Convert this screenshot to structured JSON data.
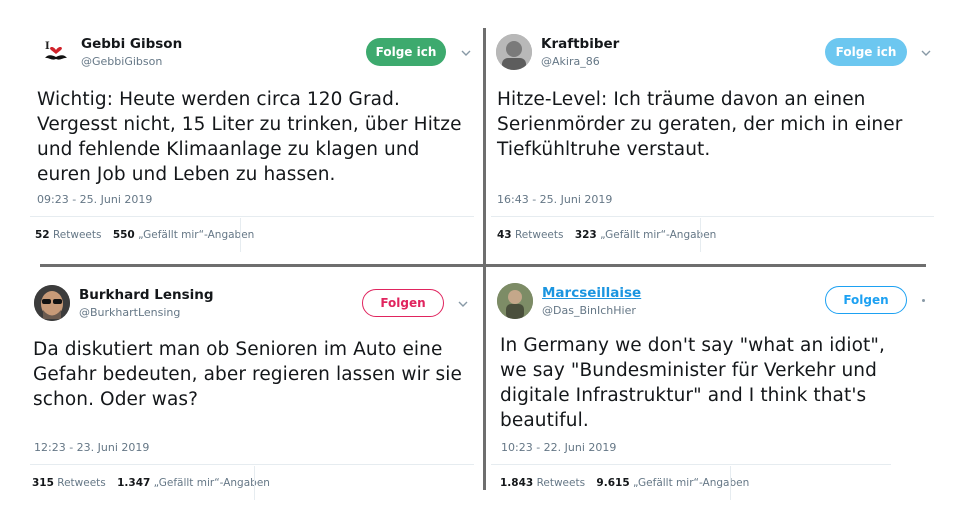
{
  "tweets": [
    {
      "name": "Gebbi Gibson",
      "handle": "@GebbiGibson",
      "follow_label": "Folge ich",
      "lines": [
        "Wichtig: Heute werden circa 120 Grad.",
        "Vergesst nicht, 15 Liter zu trinken, über Hitze",
        "und fehlende Klimaanlage zu klagen und",
        "euren Job und Leben zu hassen."
      ],
      "timestamp": "09:23 - 25. Juni 2019",
      "retweets": "52",
      "retweets_label": "Retweets",
      "likes": "550",
      "likes_label": "„Gefällt mir“-Angaben"
    },
    {
      "name": "Kraftbiber",
      "handle": "@Akira_86",
      "follow_label": "Folge ich",
      "lines": [
        "Hitze-Level: Ich träume davon an einen",
        "Serienmörder zu geraten, der mich in einer",
        "Tiefkühltruhe verstaut."
      ],
      "timestamp": "16:43 - 25. Juni 2019",
      "retweets": "43",
      "retweets_label": "Retweets",
      "likes": "323",
      "likes_label": "„Gefällt mir“-Angaben"
    },
    {
      "name": "Burkhard Lensing",
      "handle": "@BurkhartLensing",
      "follow_label": "Folgen",
      "lines": [
        "Da diskutiert man ob Senioren im Auto eine",
        "Gefahr bedeuten, aber regieren lassen wir sie",
        "schon. Oder was?"
      ],
      "timestamp": "12:23 - 23. Juni 2019",
      "retweets": "315",
      "retweets_label": "Retweets",
      "likes": "1.347",
      "likes_label": "„Gefällt mir“-Angaben"
    },
    {
      "name": "Marcseillaise",
      "handle": "@Das_BinIchHier",
      "follow_label": "Folgen",
      "lines": [
        "In Germany we don't say \"what an idiot\",",
        "we say \"Bundesminister für Verkehr und",
        "digitale Infrastruktur\" and I think that's",
        "beautiful."
      ],
      "timestamp": "10:23 - 22. Juni 2019",
      "retweets": "1.843",
      "retweets_label": "Retweets",
      "likes": "9.615",
      "likes_label": "„Gefällt mir“-Angaben"
    }
  ],
  "colors": {
    "follow_green": "#3daa6e",
    "follow_blue": "#6cc7f0",
    "follow_red_border": "#e0245e",
    "follow_blue_border": "#1da1f2",
    "link_blue": "#1b95e0"
  }
}
